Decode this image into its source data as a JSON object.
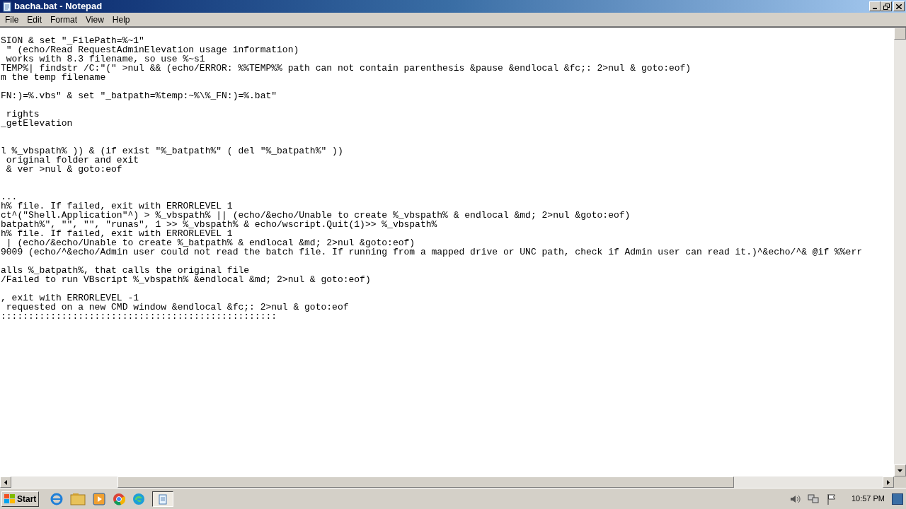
{
  "window": {
    "title": "bacha.bat - Notepad"
  },
  "menu": [
    "File",
    "Edit",
    "Format",
    "View",
    "Help"
  ],
  "lines": [
    {
      "kind": "code",
      "text": "SION & set \"_FilePath=%~1\""
    },
    {
      "kind": "code",
      "text": " \" (echo/Read RequestAdminElevation usage information)"
    },
    {
      "kind": "code",
      "text": " works with 8.3 filename, so use %~s1"
    },
    {
      "kind": "code",
      "text": "TEMP%| findstr /C:\"(\" >nul && (echo/ERROR: %%TEMP%% path can not contain parenthesis &pause &endlocal &fc;: 2>nul & goto:eof)"
    },
    {
      "kind": "code",
      "text": "m the temp filename"
    },
    {
      "kind": "blank"
    },
    {
      "kind": "code",
      "text": "FN:)=%.vbs\" & set \"_batpath=%temp:~%\\%_FN:)=%.bat\""
    },
    {
      "kind": "blank"
    },
    {
      "kind": "code",
      "text": " rights"
    },
    {
      "kind": "code",
      "text": "_getElevation"
    },
    {
      "kind": "blank"
    },
    {
      "kind": "blank"
    },
    {
      "kind": "code",
      "text": "l %_vbspath% )) & (if exist \"%_batpath%\" ( del \"%_batpath%\" ))"
    },
    {
      "kind": "code",
      "text": " original folder and exit"
    },
    {
      "kind": "code",
      "text": " & ver >nul & goto:eof"
    },
    {
      "kind": "blank"
    },
    {
      "kind": "blank"
    },
    {
      "kind": "code",
      "text": "..."
    },
    {
      "kind": "code",
      "text": "h% file. If failed, exit with ERRORLEVEL 1"
    },
    {
      "kind": "code",
      "text": "ct^(\"Shell.Application\"^) > %_vbspath% || (echo/&echo/Unable to create %_vbspath% & endlocal &md; 2>nul &goto:eof)"
    },
    {
      "kind": "code",
      "text": "batpath%\", \"\", \"\", \"runas\", 1 >> %_vbspath% & echo/wscript.Quit(1)>> %_vbspath%"
    },
    {
      "kind": "code",
      "text": "h% file. If failed, exit with ERRORLEVEL 1"
    },
    {
      "kind": "code",
      "text": " | (echo/&echo/Unable to create %_batpath% & endlocal &md; 2>nul &goto:eof)"
    },
    {
      "kind": "code",
      "text": "9009 (echo/^&echo/Admin user could not read the batch file. If running from a mapped drive or UNC path, check if Admin user can read it.)^&echo/^& @if %%err"
    },
    {
      "kind": "blank"
    },
    {
      "kind": "code",
      "text": "alls %_batpath%, that calls the original file"
    },
    {
      "kind": "code",
      "text": "/Failed to run VBscript %_vbspath% &endlocal &md; 2>nul & goto:eof)"
    },
    {
      "kind": "blank"
    },
    {
      "kind": "code",
      "text": ", exit with ERRORLEVEL -1"
    },
    {
      "kind": "code",
      "text": " requested on a new CMD window &endlocal &fc;: 2>nul & goto:eof"
    },
    {
      "kind": "code",
      "text": "::::::::::::::::::::::::::::::::::::::::::::::::::"
    }
  ],
  "taskbar": {
    "start_label": "Start",
    "clock": "10:57 PM"
  }
}
